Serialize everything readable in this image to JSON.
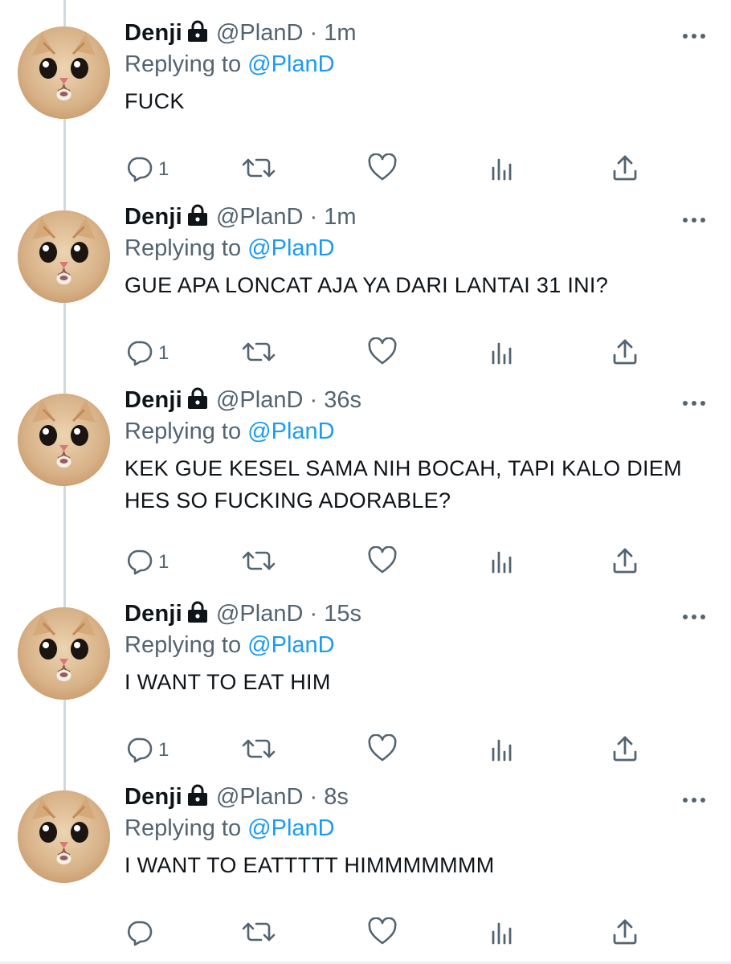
{
  "tweets": [
    {
      "name": "Denji",
      "handle": "@PlanD",
      "dot": "·",
      "time": "1m",
      "replying_prefix": "Replying to",
      "replying_to": "@PlanD",
      "text": "FUCK",
      "reply_count": "1"
    },
    {
      "name": "Denji",
      "handle": "@PlanD",
      "dot": "·",
      "time": "1m",
      "replying_prefix": "Replying to",
      "replying_to": "@PlanD",
      "text": "GUE APA LONCAT AJA YA DARI LANTAI 31 INI?",
      "reply_count": "1"
    },
    {
      "name": "Denji",
      "handle": "@PlanD",
      "dot": "·",
      "time": "36s",
      "replying_prefix": "Replying to",
      "replying_to": "@PlanD",
      "text": "KEK GUE KESEL SAMA NIH BOCAH, TAPI KALO DIEM HES SO FUCKING ADORABLE?",
      "reply_count": "1"
    },
    {
      "name": "Denji",
      "handle": "@PlanD",
      "dot": "·",
      "time": "15s",
      "replying_prefix": "Replying to",
      "replying_to": "@PlanD",
      "text": "I WANT TO EAT HIM",
      "reply_count": "1"
    },
    {
      "name": "Denji",
      "handle": "@PlanD",
      "dot": "·",
      "time": "8s",
      "replying_prefix": "Replying to",
      "replying_to": "@PlanD",
      "text": "I WANT TO EATTTTT HIMMMMMMM",
      "reply_count": ""
    }
  ],
  "icons": {
    "lock": "lock-icon",
    "more": "more-icon",
    "reply": "reply-icon",
    "retweet": "retweet-icon",
    "like": "heart-icon",
    "views": "views-icon",
    "share": "share-icon",
    "avatar": "cat-avatar"
  },
  "colors": {
    "link": "#1d9bf0",
    "secondary_text": "#536471",
    "primary_text": "#0f1419",
    "thread_line": "#cfd9de"
  }
}
